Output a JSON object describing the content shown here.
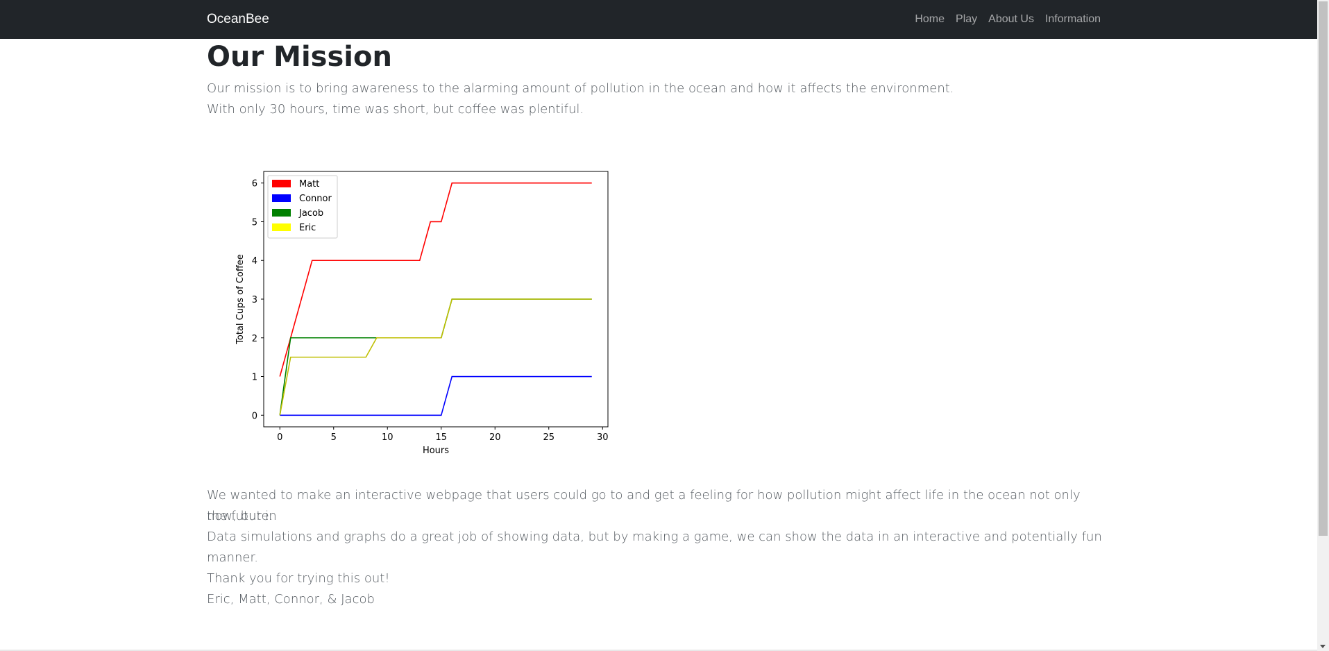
{
  "navbar": {
    "brand": "OceanBee",
    "links": [
      "Home",
      "Play",
      "About Us",
      "Information"
    ]
  },
  "main": {
    "title": "Our Mission",
    "intro_line1": "Our mission is to bring awareness to the alarming amount of pollution in the ocean and how it affects the environment.",
    "intro_line2": "With only 30 hours, time was short, but coffee was plentiful.",
    "para1_line1": "We wanted to make an interactive webpage that users could go to and get a feeling for how pollution might affect life in the ocean not only now, but in",
    "para1_line2": "the future.",
    "para2": "Data simulations and graphs do a great job of showing data, but by making a game, we can show the data in an interactive and potentially fun manner.",
    "thanks": "Thank you for trying this out!",
    "signature": "Eric, Matt, Connor, & Jacob"
  },
  "chart_data": {
    "type": "line",
    "xlabel": "Hours",
    "ylabel": "Total Cups of Coffee",
    "xlim": [
      -1.5,
      30.5
    ],
    "ylim": [
      -0.3,
      6.3
    ],
    "xticks": [
      0,
      5,
      10,
      15,
      20,
      25,
      30
    ],
    "yticks": [
      0,
      1,
      2,
      3,
      4,
      5,
      6
    ],
    "legend_position": "top-left",
    "series": [
      {
        "name": "Matt",
        "color": "#ff0000",
        "x": [
          0,
          1,
          3,
          13,
          14,
          15,
          16,
          29
        ],
        "y": [
          1,
          2,
          4,
          4,
          5,
          5,
          6,
          6
        ]
      },
      {
        "name": "Connor",
        "color": "#0000ff",
        "x": [
          0,
          15,
          16,
          29
        ],
        "y": [
          0,
          0,
          1,
          1
        ]
      },
      {
        "name": "Jacob",
        "color": "#008000",
        "x": [
          0,
          1,
          15,
          16,
          29
        ],
        "y": [
          0,
          2,
          2,
          3,
          3
        ]
      },
      {
        "name": "Eric",
        "color": "#bfbf00",
        "legend_color": "#ffff00",
        "x": [
          0,
          1,
          8,
          9,
          15,
          16,
          29
        ],
        "y": [
          0,
          1.5,
          1.5,
          2,
          2,
          3,
          3
        ]
      }
    ]
  }
}
